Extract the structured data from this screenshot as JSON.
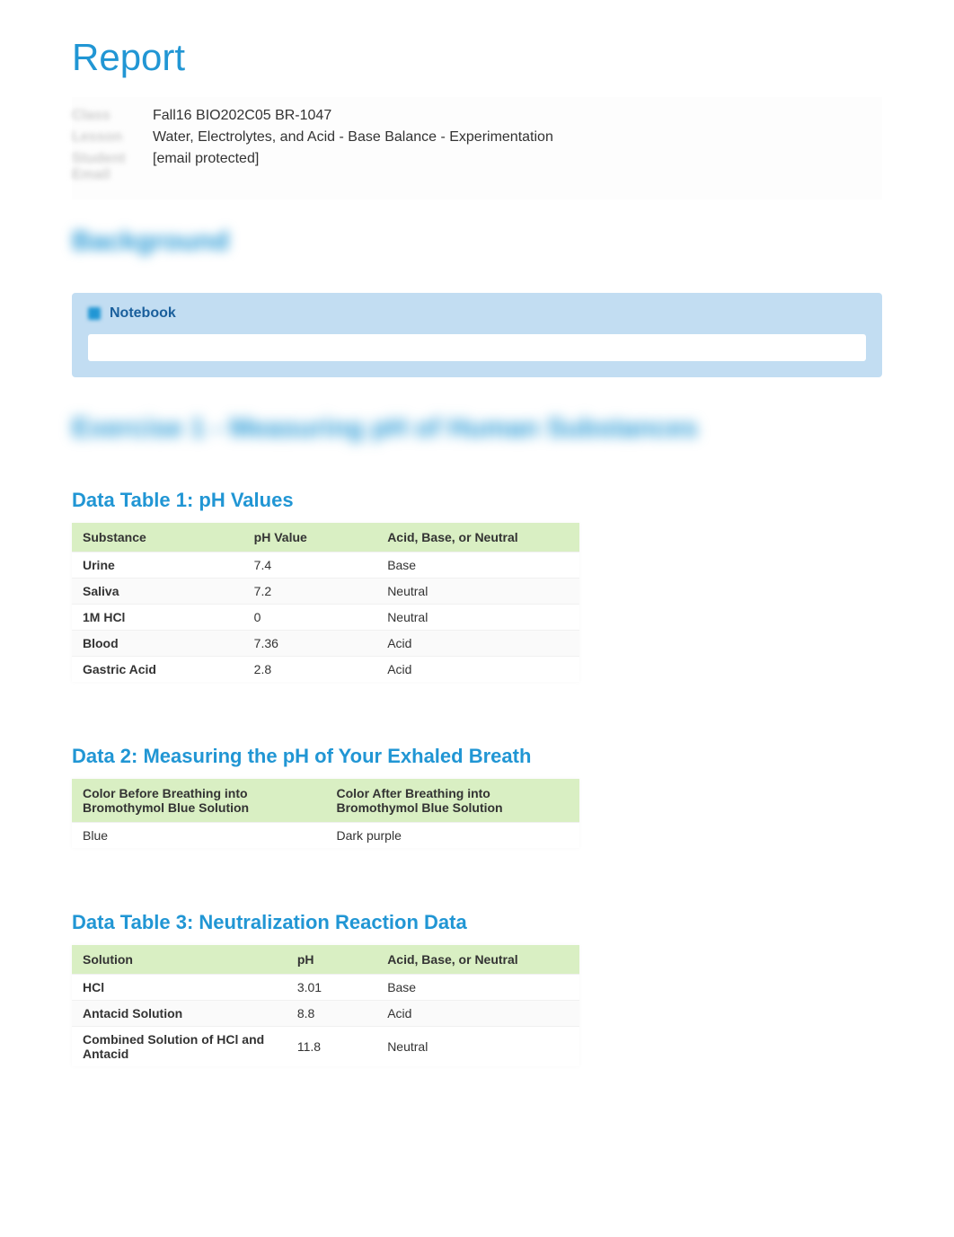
{
  "title": "Report",
  "meta": {
    "row1_label": "Class",
    "row1_value": "Fall16 BIO202C05 BR-1047",
    "row2_label": "Lesson",
    "row2_value": "Water, Electrolytes, and Acid - Base Balance - Experimentation",
    "row3_label": "Student Email",
    "row3_value": "[email protected]"
  },
  "background_heading": "Background",
  "notebook": {
    "title": "Notebook"
  },
  "exercise_heading": "Exercise 1 - Measuring pH of Human Substances",
  "table1": {
    "title": "Data Table 1: pH Values",
    "headers": [
      "Substance",
      "pH Value",
      "Acid, Base, or Neutral"
    ],
    "rows": [
      {
        "substance": "Urine",
        "ph": "7.4",
        "abn": "Base"
      },
      {
        "substance": "Saliva",
        "ph": "7.2",
        "abn": "Neutral"
      },
      {
        "substance": "1M HCl",
        "ph": "0",
        "abn": "Neutral"
      },
      {
        "substance": "Blood",
        "ph": "7.36",
        "abn": "Acid"
      },
      {
        "substance": "Gastric Acid",
        "ph": "2.8",
        "abn": "Acid"
      }
    ]
  },
  "table2": {
    "title": "Data 2: Measuring the pH of Your Exhaled Breath",
    "headers": [
      "Color Before Breathing into Bromothymol Blue Solution",
      "Color After Breathing into Bromothymol Blue Solution"
    ],
    "rows": [
      {
        "before": "Blue",
        "after": " Dark purple"
      }
    ]
  },
  "table3": {
    "title": "Data Table 3: Neutralization Reaction Data",
    "headers": [
      "Solution",
      "pH",
      "Acid, Base, or Neutral"
    ],
    "rows": [
      {
        "solution": "HCl",
        "ph": "3.01",
        "abn": "Base"
      },
      {
        "solution": "Antacid Solution",
        "ph": "8.8",
        "abn": "Acid"
      },
      {
        "solution": "Combined Solution of HCl and Antacid",
        "ph": "11.8",
        "abn": "Neutral"
      }
    ]
  }
}
